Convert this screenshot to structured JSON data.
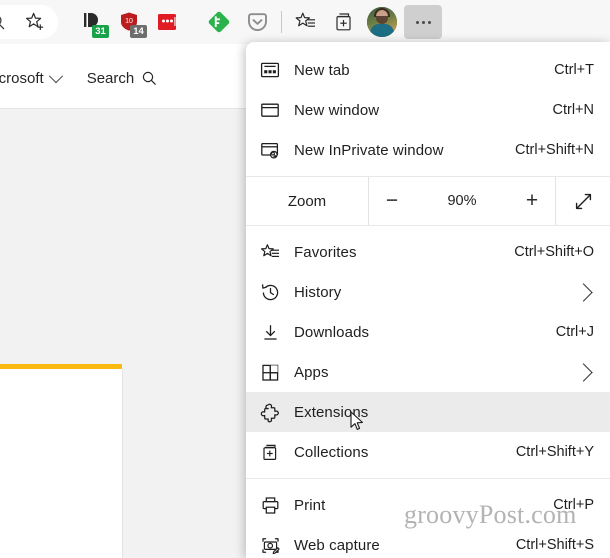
{
  "toolbar": {
    "buttons": [
      {
        "name": "search-icon",
        "label": "Search"
      },
      {
        "name": "add-favorite-icon",
        "label": "Add this page to favorites"
      },
      {
        "name": "extension-docs-icon",
        "label": "Extension",
        "badge": "31",
        "badge_color": "#1aa24a"
      },
      {
        "name": "extension-calendar-icon",
        "label": "Extension",
        "badge": "14",
        "badge_color": "#6d6d6d"
      },
      {
        "name": "extension-red-icon",
        "label": "Extension"
      },
      {
        "name": "feedly-icon",
        "label": "Feedly"
      },
      {
        "name": "pocket-icon",
        "label": "Pocket"
      },
      {
        "name": "favorites-toolbar-icon",
        "label": "Favorites"
      },
      {
        "name": "collections-toolbar-icon",
        "label": "Collections"
      },
      {
        "name": "profile-avatar",
        "label": "Profile"
      },
      {
        "name": "settings-and-more-button",
        "label": "Settings and more"
      }
    ]
  },
  "page": {
    "nav": {
      "scope_label": "All Microsoft",
      "search_label": "Search"
    },
    "accent_color": "#fbb914"
  },
  "menu": {
    "items": [
      {
        "id": "new-tab",
        "icon": "new-tab-icon",
        "label": "New tab",
        "accel": "Ctrl+T",
        "submenu": false,
        "selected": false
      },
      {
        "id": "new-window",
        "icon": "new-window-icon",
        "label": "New window",
        "accel": "Ctrl+N",
        "submenu": false,
        "selected": false
      },
      {
        "id": "new-inprivate",
        "icon": "new-inprivate-icon",
        "label": "New InPrivate window",
        "accel": "Ctrl+Shift+N",
        "submenu": false,
        "selected": false
      },
      {
        "id": "favorites",
        "icon": "favorites-icon",
        "label": "Favorites",
        "accel": "Ctrl+Shift+O",
        "submenu": false,
        "selected": false
      },
      {
        "id": "history",
        "icon": "history-icon",
        "label": "History",
        "accel": "",
        "submenu": true,
        "selected": false
      },
      {
        "id": "downloads",
        "icon": "downloads-icon",
        "label": "Downloads",
        "accel": "Ctrl+J",
        "submenu": false,
        "selected": false
      },
      {
        "id": "apps",
        "icon": "apps-icon",
        "label": "Apps",
        "accel": "",
        "submenu": true,
        "selected": false
      },
      {
        "id": "extensions",
        "icon": "extensions-icon",
        "label": "Extensions",
        "accel": "",
        "submenu": false,
        "selected": true
      },
      {
        "id": "collections",
        "icon": "collections-icon",
        "label": "Collections",
        "accel": "Ctrl+Shift+Y",
        "submenu": false,
        "selected": false
      },
      {
        "id": "print",
        "icon": "print-icon",
        "label": "Print",
        "accel": "Ctrl+P",
        "submenu": false,
        "selected": false
      },
      {
        "id": "web-capture",
        "icon": "web-capture-icon",
        "label": "Web capture",
        "accel": "Ctrl+Shift+S",
        "submenu": false,
        "selected": false
      }
    ],
    "zoom": {
      "label": "Zoom",
      "level": "90%",
      "minus_label": "−",
      "plus_label": "+",
      "fullscreen_icon": "fullscreen-icon"
    },
    "highlight_color": "#ebebeb"
  },
  "watermark": {
    "text": "groovyPost.com"
  }
}
